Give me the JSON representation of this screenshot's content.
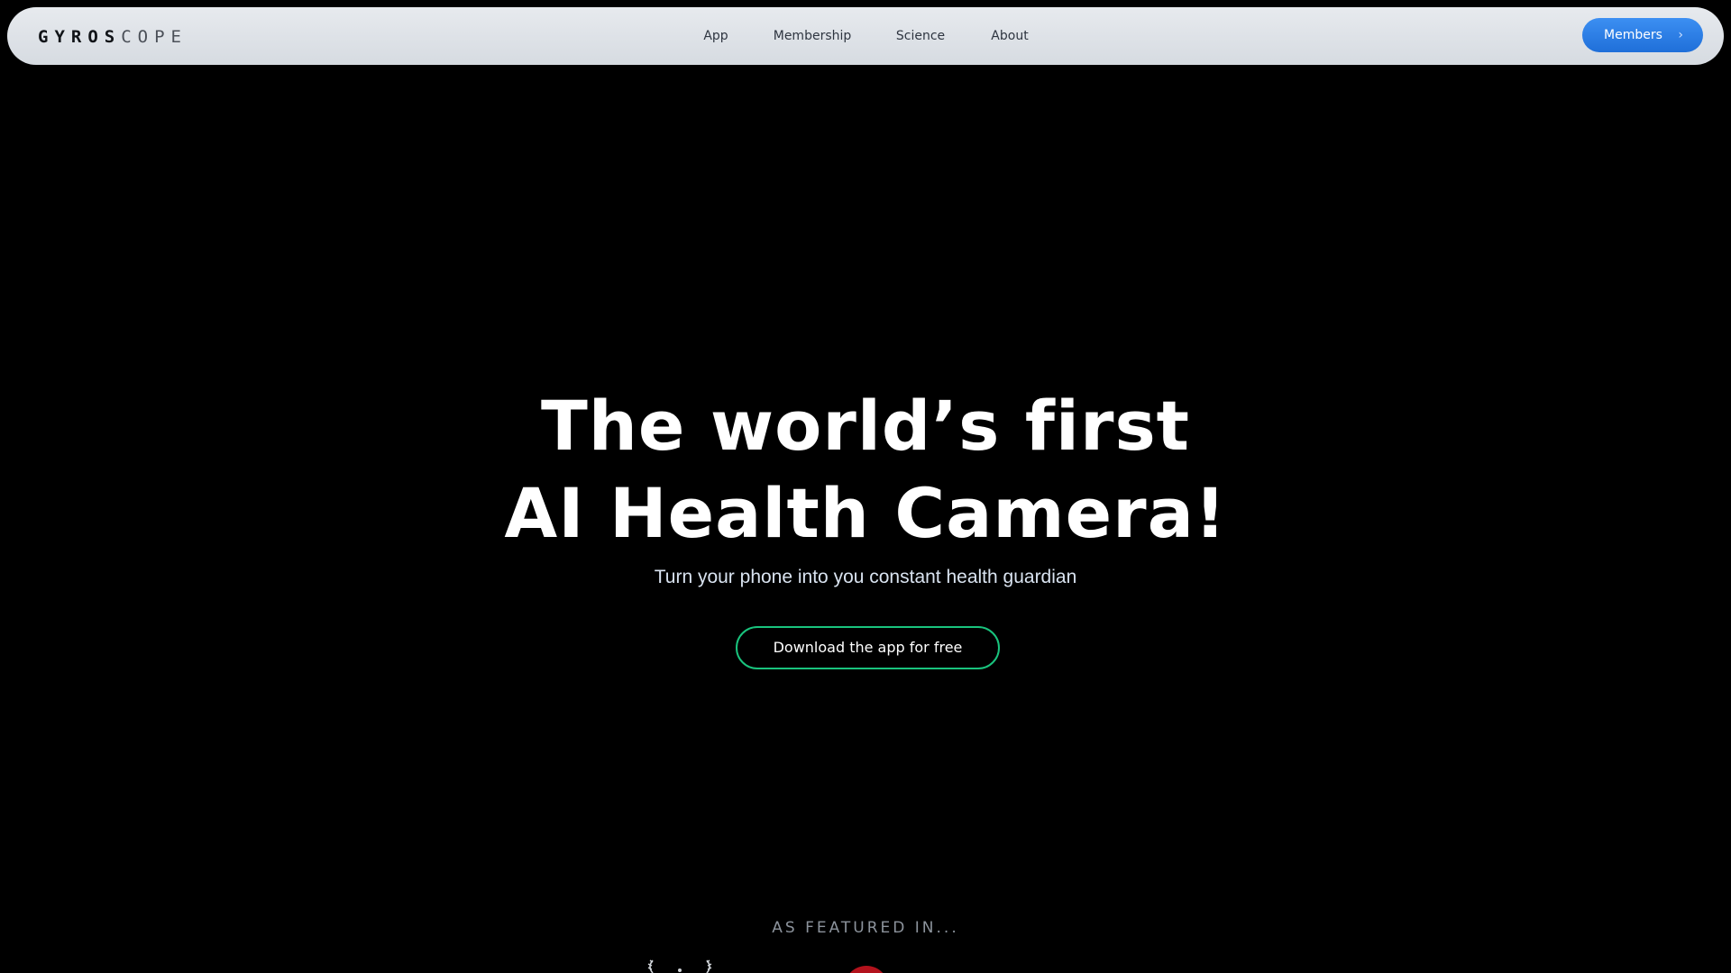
{
  "brand": {
    "logo_strong": "GYROS",
    "logo_light": "COPE"
  },
  "nav": {
    "links": [
      {
        "label": "App"
      },
      {
        "label": "Membership"
      },
      {
        "label": "Science"
      },
      {
        "label": "About"
      }
    ],
    "members_label": "Members"
  },
  "hero": {
    "title_line1": "The world’s first",
    "title_line2": "AI Health Camera!",
    "subtitle": "Turn your phone into you constant health guardian",
    "cta_label": "Download the app for free"
  },
  "featured": {
    "heading": "AS FEATURED IN..."
  },
  "colors": {
    "background": "#000000",
    "nav_background": "#e1e5ea",
    "members_button": "#2a7fe6",
    "cta_border": "#19c37d",
    "featured_text": "#8c939c"
  },
  "icons": {
    "members_chevron": "chevron-right-icon",
    "featured_logo_1": "laurel-icon",
    "featured_logo_2": "red-circle-logo"
  }
}
